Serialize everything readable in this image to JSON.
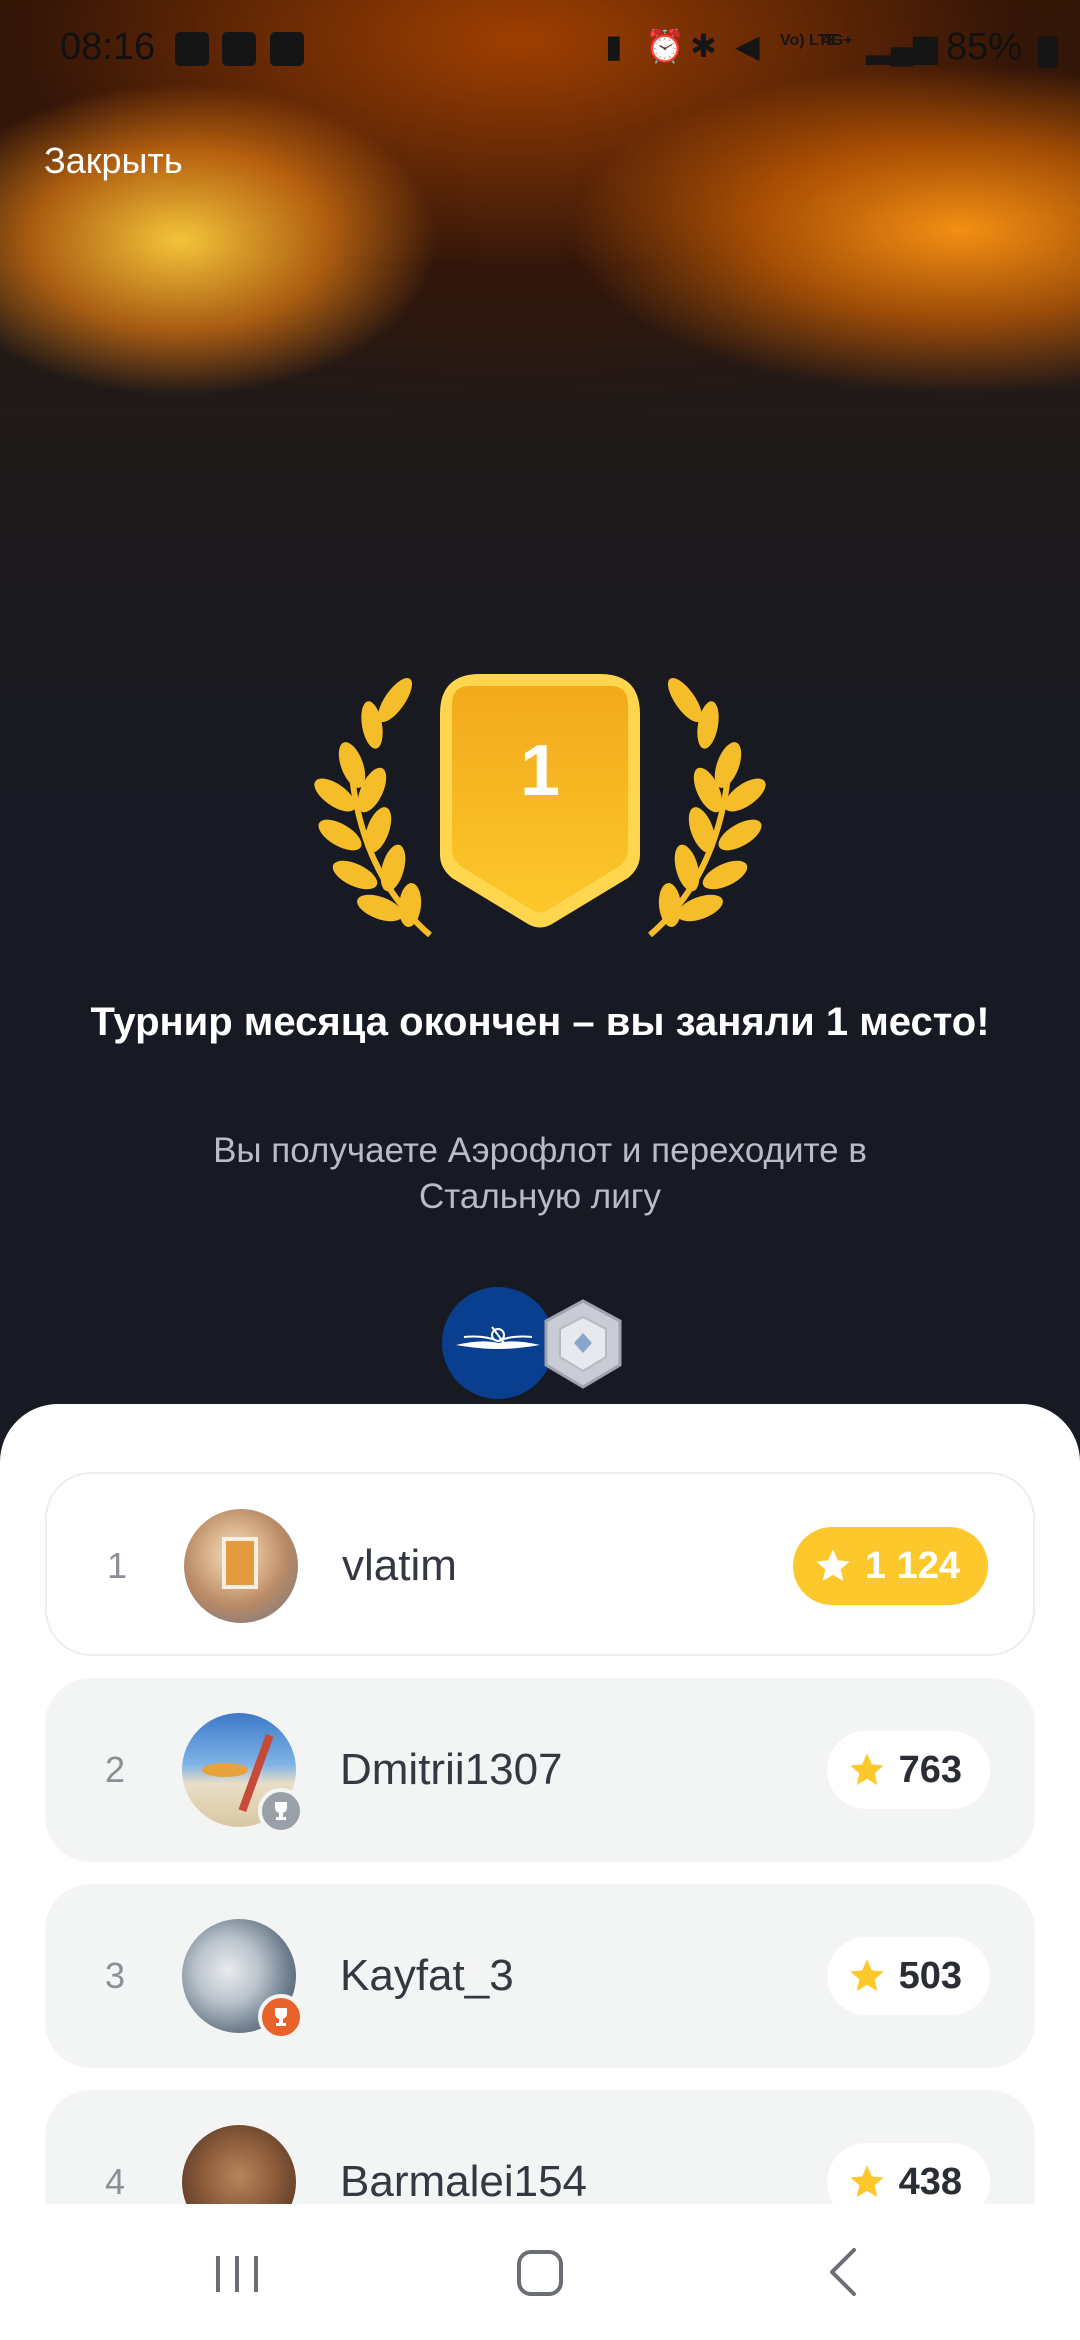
{
  "status_bar": {
    "time": "08:16",
    "battery": "85%",
    "signal_label": "4G+",
    "volte_label": "Vo) LTE"
  },
  "close_label": "Закрыть",
  "badge": {
    "place_number": "1",
    "color": "#fcc82b"
  },
  "title": "Турнир месяца окончен – вы заняли 1 место!",
  "subtitle": "Вы получаете Аэрофлот и переходите в Стальную лигу",
  "rewards": {
    "items": [
      "aeroflot-logo",
      "steel-league-icon"
    ]
  },
  "leaderboard": {
    "rows": [
      {
        "rank": "1",
        "name": "vlatim",
        "score": "1 124",
        "badge": ""
      },
      {
        "rank": "2",
        "name": "Dmitrii1307",
        "score": "763",
        "badge": "silver-trophy-icon"
      },
      {
        "rank": "3",
        "name": "Kayfat_3",
        "score": "503",
        "badge": "bronze-trophy-icon"
      },
      {
        "rank": "4",
        "name": "Barmalei154",
        "score": "438",
        "badge": ""
      }
    ]
  },
  "nav": {
    "buttons": [
      "recent-apps-icon",
      "home-icon",
      "back-icon"
    ]
  },
  "colors": {
    "accent_gold": "#fcc82b",
    "background_dark": "#171a22",
    "aeroflot_blue": "#0a3f8f"
  }
}
